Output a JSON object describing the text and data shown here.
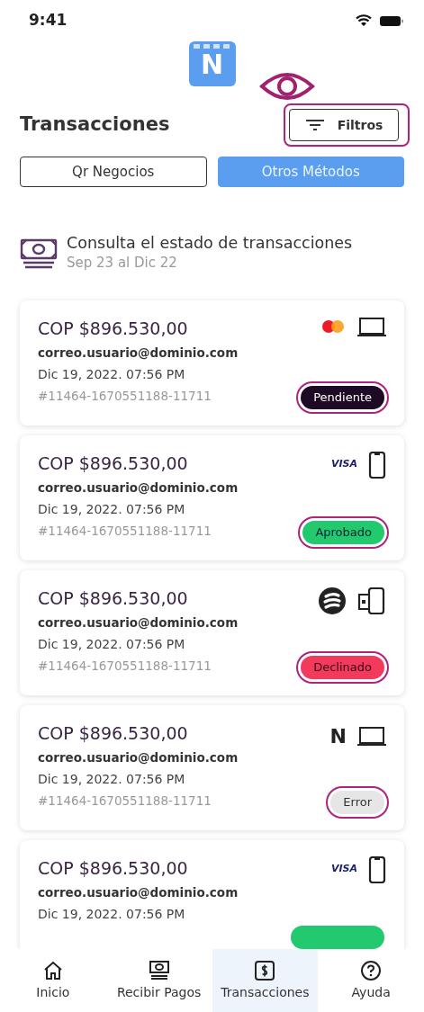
{
  "status_bar": {
    "time": "9:41"
  },
  "logo": {
    "letter": "N"
  },
  "header": {
    "title": "Transacciones",
    "filter_button": {
      "label": "Filtros",
      "highlighted": true
    }
  },
  "segments": [
    {
      "label": "Qr Negocios",
      "selected": false
    },
    {
      "label": "Otros Métodos",
      "selected": true
    }
  ],
  "summary": {
    "title": "Consulta el estado de transacciones",
    "range": "Sep 23 al Dic 22"
  },
  "transactions": [
    {
      "amount": "COP $896.530,00",
      "email": "correo.usuario@dominio.com",
      "date": "Dic 19, 2022. 07:56 PM",
      "reference": "#11464-1670551188-11711",
      "payment": {
        "kind": "mastercard"
      },
      "device": {
        "kind": "laptop"
      },
      "status": {
        "kind": "pending",
        "label": "Pendiente",
        "highlighted": true
      }
    },
    {
      "amount": "COP $896.530,00",
      "email": "correo.usuario@dominio.com",
      "date": "Dic 19, 2022. 07:56 PM",
      "reference": "#11464-1670551188-11711",
      "payment": {
        "kind": "visa",
        "label": "VISA"
      },
      "device": {
        "kind": "phone"
      },
      "status": {
        "kind": "approved",
        "label": "Aprobado",
        "highlighted": true
      }
    },
    {
      "amount": "COP $896.530,00",
      "email": "correo.usuario@dominio.com",
      "date": "Dic 19, 2022. 07:56 PM",
      "reference": "#11464-1670551188-11711",
      "payment": {
        "kind": "wallet"
      },
      "device": {
        "kind": "phone-card"
      },
      "status": {
        "kind": "declined",
        "label": "Declinado",
        "highlighted": true
      }
    },
    {
      "amount": "COP $896.530,00",
      "email": "correo.usuario@dominio.com",
      "date": "Dic 19, 2022. 07:56 PM",
      "reference": "#11464-1670551188-11711",
      "payment": {
        "kind": "brand",
        "label": "N"
      },
      "device": {
        "kind": "laptop"
      },
      "status": {
        "kind": "error",
        "label": "Error",
        "highlighted": true
      }
    },
    {
      "amount": "COP $896.530,00",
      "email": "correo.usuario@dominio.com",
      "date": "Dic 19, 2022. 07:56 PM",
      "payment": {
        "kind": "visa",
        "label": "VISA"
      },
      "device": {
        "kind": "phone"
      },
      "status": {
        "kind": "approved"
      }
    }
  ],
  "nav": [
    {
      "label": "Inicio",
      "selected": false
    },
    {
      "label": "Recibir Pagos",
      "selected": false
    },
    {
      "label": "Transacciones",
      "selected": true
    },
    {
      "label": "Ayuda",
      "selected": false
    }
  ]
}
